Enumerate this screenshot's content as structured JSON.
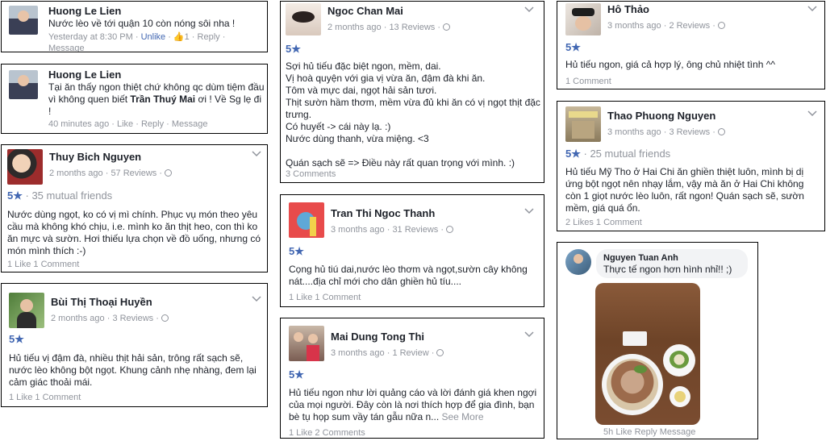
{
  "c1": {
    "name": "Huong Le Lien",
    "text": "Nước lèo về tới quận 10 còn nóng sôi nha !",
    "time": "Yesterday at 8:30 PM",
    "unlike": "Unlike",
    "likes": "1",
    "reply": "Reply",
    "message": "Message"
  },
  "c2": {
    "name": "Huong Le Lien",
    "text_before": "Tại ăn thấy ngon thiệt chứ không qc dùm tiệm đầu vì không quen biết ",
    "mention": "Trần Thuý Mai",
    "text_after": " ơi ! Về Sg lẹ đi !",
    "time": "40 minutes ago",
    "like": "Like",
    "reply": "Reply",
    "message": "Message"
  },
  "r1": {
    "name": "Thuy Bich Nguyen",
    "time": "2 months ago",
    "reviews": "57 Reviews",
    "rating": "5★",
    "mutual": "35 mutual friends",
    "text": "Nước dùng ngọt, ko có vị mì chính. Phục vụ món theo yêu cầu mà không khó chịu, i.e. mình ko ăn thịt heo, con thì ko ăn mực và sườn.  Hơi thiếu lựa chọn về đồ uống, nhưng có món mình thích :-)",
    "likes": "1 Like",
    "comments": "1 Comment"
  },
  "r2": {
    "name": "Bùi Thị Thoại Huyền",
    "time": "2 months ago",
    "reviews": "3 Reviews",
    "rating": "5★",
    "text": "Hủ tiếu vị đậm đà, nhiều thịt hải sản, trông rất sạch sẽ, nước lèo không bột ngọt. Khung cảnh nhẹ nhàng, đem lại cảm giác thoải mái.",
    "likes": "1 Like",
    "comments": "1 Comment"
  },
  "r3": {
    "name": "Ngoc Chan Mai",
    "time": "2 months ago",
    "reviews": "13 Reviews",
    "rating": "5★",
    "lines": [
      "Sợi hủ tiếu đặc biệt ngon, mềm, dai.",
      "Vị hoà quyện với gia vị vừa ăn, đậm đà khi ăn.",
      "Tôm và mực dai, ngọt hải sản tươi.",
      "Thịt sườn hầm thơm, mềm vừa đủ khi ăn có vị ngọt thịt đặc trưng.",
      "Có huyết -> cái này lạ. :)",
      "Nước dùng thanh, vừa miệng. <3",
      "",
      "Quán sạch sẽ => Điều này rất quan trọng với mình. :)"
    ],
    "comments": "3 Comments"
  },
  "r4": {
    "name": "Tran Thi Ngoc Thanh",
    "time": "3 months ago",
    "reviews": "31 Reviews",
    "rating": "5★",
    "text": "Cọng hủ tiú dai,nước lèo thơm và ngọt,sườn cây không nát....địa chỉ mới cho dân ghiền hủ tíu....",
    "likes": "1 Like",
    "comments": "1 Comment"
  },
  "r5": {
    "name": "Mai Dung Tong Thi",
    "time": "3 months ago",
    "reviews": "1 Review",
    "rating": "5★",
    "text": "Hủ tiếu ngon như lời quảng cáo và lời đánh giá khen ngợi của mọi người. Đây còn là nơi thích hợp để gia đình, bạn bè tụ họp sum vầy tán gẫu nữa n...",
    "see_more": "See More",
    "likes": "1 Like",
    "comments": "2 Comments"
  },
  "r6": {
    "name": "Hô Thảo",
    "time": "3 months ago",
    "reviews": "2 Reviews",
    "rating": "5★",
    "text": "Hủ tiếu ngon, giá cả hợp lý, ông chủ nhiệt tình ^^",
    "comments": "1 Comment"
  },
  "r7": {
    "name": "Thao Phuong Nguyen",
    "time": "3 months ago",
    "reviews": "3 Reviews",
    "rating": "5★",
    "mutual": "25 mutual friends",
    "text": "Hủ tiếu Mỹ Tho ở Hai Chi ăn ghiền thiệt luôn, mình bị dị ứng bột ngọt nên nhạy lắm, vậy mà ăn ở Hai Chi không còn 1 giọt nước lèo luôn, rất ngon! Quán sạch sẽ, sườn mềm, giá quá ổn.",
    "likes": "2 Likes",
    "comments": "1 Comment"
  },
  "c3": {
    "name": "Nguyen Tuan Anh",
    "text": "Thực tế ngon hơn hình nhỉ!! ;)",
    "time": "5h",
    "like": "Like",
    "reply": "Reply",
    "message": "Message"
  }
}
